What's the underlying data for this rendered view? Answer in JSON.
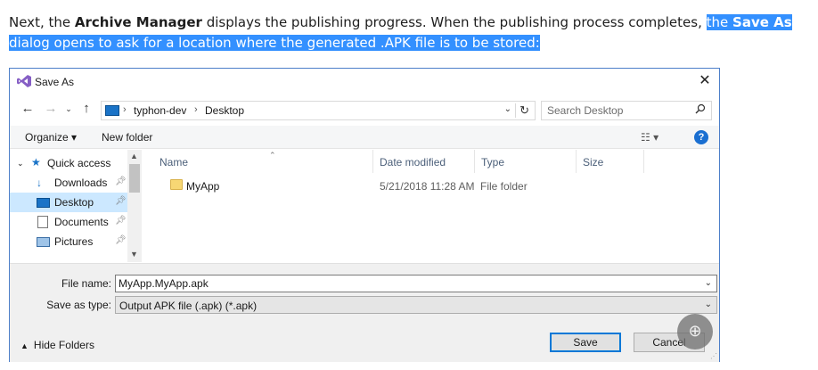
{
  "doc": {
    "part1": "Next, the ",
    "bold1": "Archive Manager",
    "part2": " displays the publishing progress. When the publishing process completes, ",
    "hl1": "the ",
    "hl_bold": "Save As",
    "hl2": " dialog opens to ask for a location where the generated .APK file is to be stored:"
  },
  "dialog": {
    "title": "Save As",
    "close_glyph": "✕",
    "address": {
      "crumbs": [
        "typhon-dev",
        "Desktop"
      ],
      "separator": "›"
    },
    "search": {
      "placeholder": "Search Desktop"
    },
    "toolbar": {
      "organize": "Organize ▾",
      "new_folder": "New folder",
      "help": "?"
    },
    "nav": {
      "items": [
        {
          "label": "Quick access",
          "icon": "star-icon"
        },
        {
          "label": "Downloads",
          "icon": "download-arrow-icon"
        },
        {
          "label": "Desktop",
          "icon": "desktop-icon"
        },
        {
          "label": "Documents",
          "icon": "documents-icon"
        },
        {
          "label": "Pictures",
          "icon": "pictures-icon"
        }
      ]
    },
    "columns": [
      "Name",
      "Date modified",
      "Type",
      "Size"
    ],
    "rows": [
      {
        "name": "MyApp",
        "date": "5/21/2018 11:28 AM",
        "type": "File folder",
        "size": ""
      }
    ],
    "file_name": {
      "label": "File name:",
      "value": "MyApp.MyApp.apk"
    },
    "save_type": {
      "label": "Save as type:",
      "value": "Output APK file (.apk) (*.apk)"
    },
    "hide_folders": "Hide Folders",
    "save_button": "Save",
    "cancel_button": "Cancel"
  },
  "colors": {
    "highlight": "#3390ff",
    "selected_nav": "#cce8ff",
    "accent": "#0078d7"
  }
}
